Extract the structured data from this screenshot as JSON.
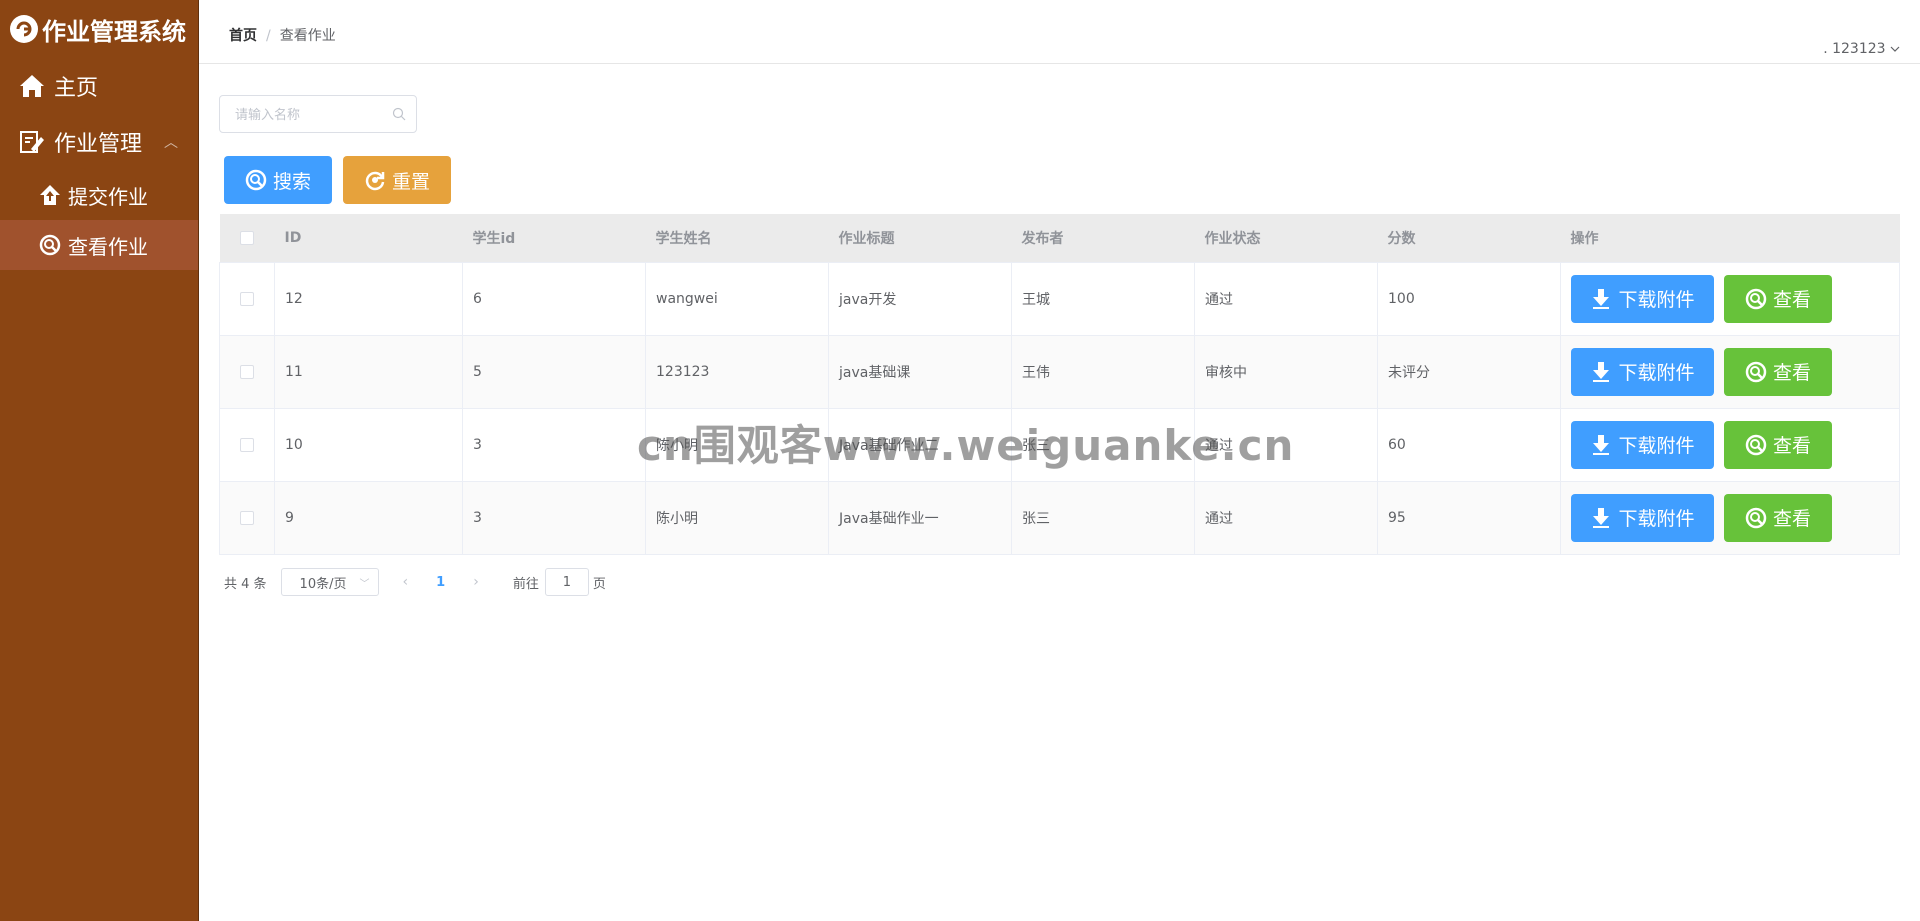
{
  "app": {
    "title": "作业管理系统"
  },
  "sidebar": {
    "items": [
      {
        "label": "主页",
        "icon": "home-icon"
      },
      {
        "label": "作业管理",
        "icon": "edit-icon",
        "expanded": true,
        "children": [
          {
            "label": "提交作业",
            "icon": "upload-icon",
            "active": false
          },
          {
            "label": "查看作业",
            "icon": "search-circle-icon",
            "active": true
          }
        ]
      }
    ]
  },
  "header": {
    "breadcrumb": [
      "首页",
      "查看作业"
    ],
    "user": ". 123123"
  },
  "search": {
    "placeholder": "请输入名称",
    "search_button": "搜索",
    "reset_button": "重置"
  },
  "table": {
    "columns": [
      "ID",
      "学生id",
      "学生姓名",
      "作业标题",
      "发布者",
      "作业状态",
      "分数",
      "操作"
    ],
    "rows": [
      {
        "id": "12",
        "student_id": "6",
        "student_name": "wangwei",
        "title": "java开发",
        "publisher": "王城",
        "status": "通过",
        "score": "100"
      },
      {
        "id": "11",
        "student_id": "5",
        "student_name": "123123",
        "title": "java基础课",
        "publisher": "王伟",
        "status": "审核中",
        "score": "未评分"
      },
      {
        "id": "10",
        "student_id": "3",
        "student_name": "陈小明",
        "title": "Java基础作业二",
        "publisher": "张三",
        "status": "通过",
        "score": "60"
      },
      {
        "id": "9",
        "student_id": "3",
        "student_name": "陈小明",
        "title": "Java基础作业一",
        "publisher": "张三",
        "status": "通过",
        "score": "95"
      }
    ],
    "download_label": "下载附件",
    "view_label": "查看"
  },
  "pagination": {
    "total": "共 4 条",
    "page_size": "10条/页",
    "current_page": "1",
    "goto_label": "前往",
    "goto_value": "1",
    "page_suffix": "页"
  },
  "watermark": "cn围观客www.weiguanke.cn",
  "colors": {
    "sidebar_bg": "#8b4513",
    "sidebar_active": "#a0522d",
    "primary": "#409eff",
    "warning": "#e6a23c",
    "success": "#67c23a"
  }
}
